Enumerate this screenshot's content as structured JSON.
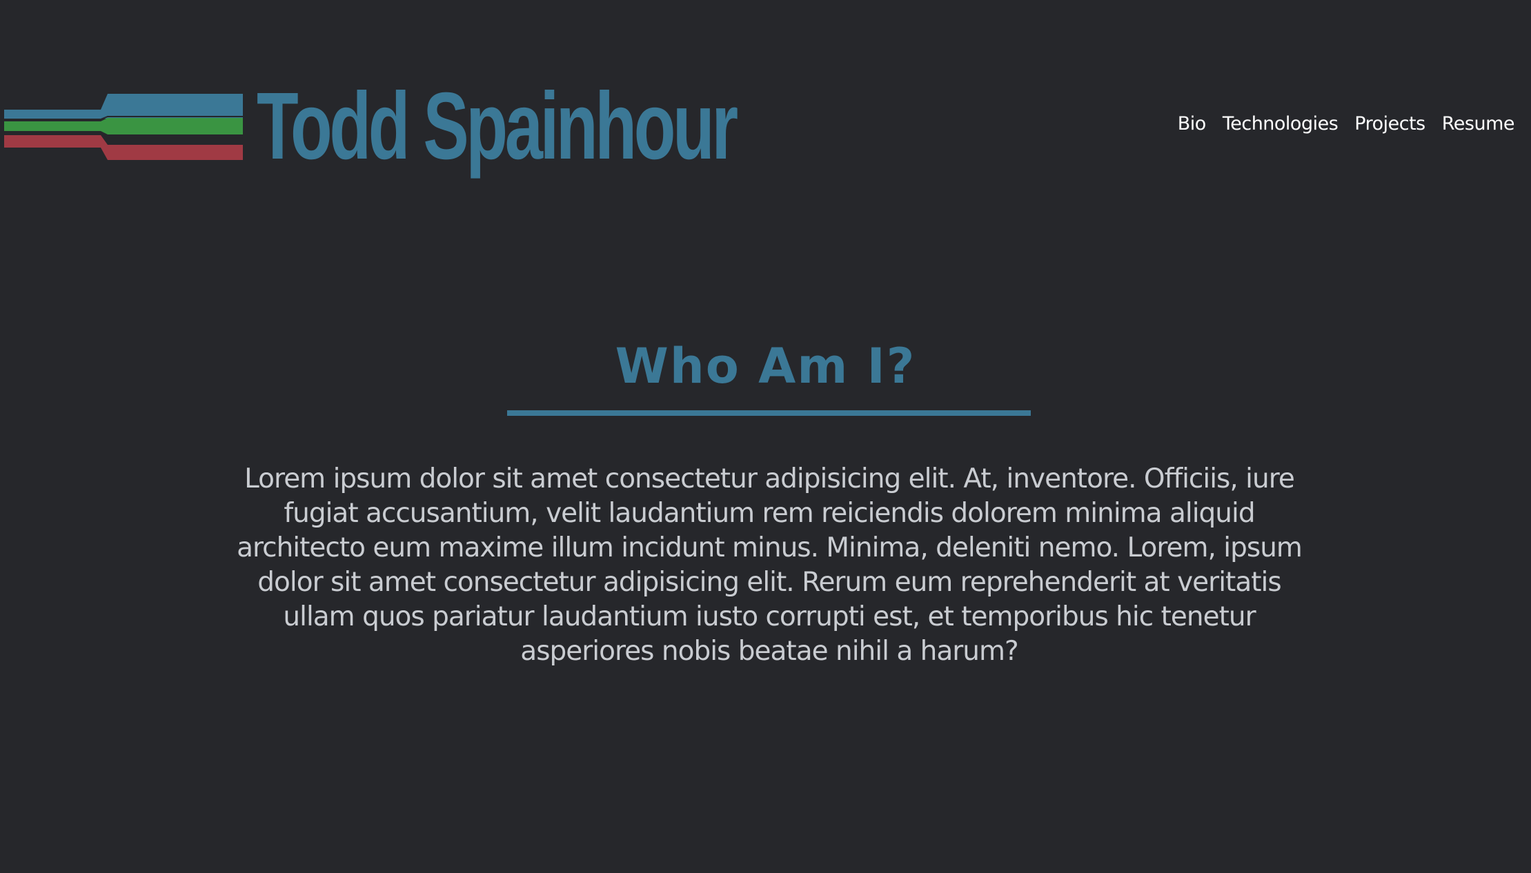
{
  "header": {
    "site_title": "Todd Spainhour",
    "logo_colors": {
      "blue": "#3b7896",
      "green": "#3a9442",
      "red": "#a03a44"
    }
  },
  "nav": {
    "items": [
      {
        "label": "Bio"
      },
      {
        "label": "Technologies"
      },
      {
        "label": "Projects"
      },
      {
        "label": "Resume"
      }
    ]
  },
  "main": {
    "heading": "Who Am I?",
    "bio": "Lorem ipsum dolor sit amet consectetur adipisicing elit. At, inventore. Officiis, iure fugiat accusantium, velit laudantium rem reiciendis dolorem minima aliquid architecto eum maxime illum incidunt minus. Minima, deleniti nemo. Lorem, ipsum dolor sit amet consectetur adipisicing elit. Rerum eum reprehenderit at veritatis ullam quos pariatur laudantium iusto corrupti est, et temporibus hic tenetur asperiores nobis beatae nihil a harum?"
  },
  "theme": {
    "background": "#26272b",
    "accent": "#3b7896",
    "nav_text": "#ffffff",
    "body_text": "#c9ccd1"
  }
}
